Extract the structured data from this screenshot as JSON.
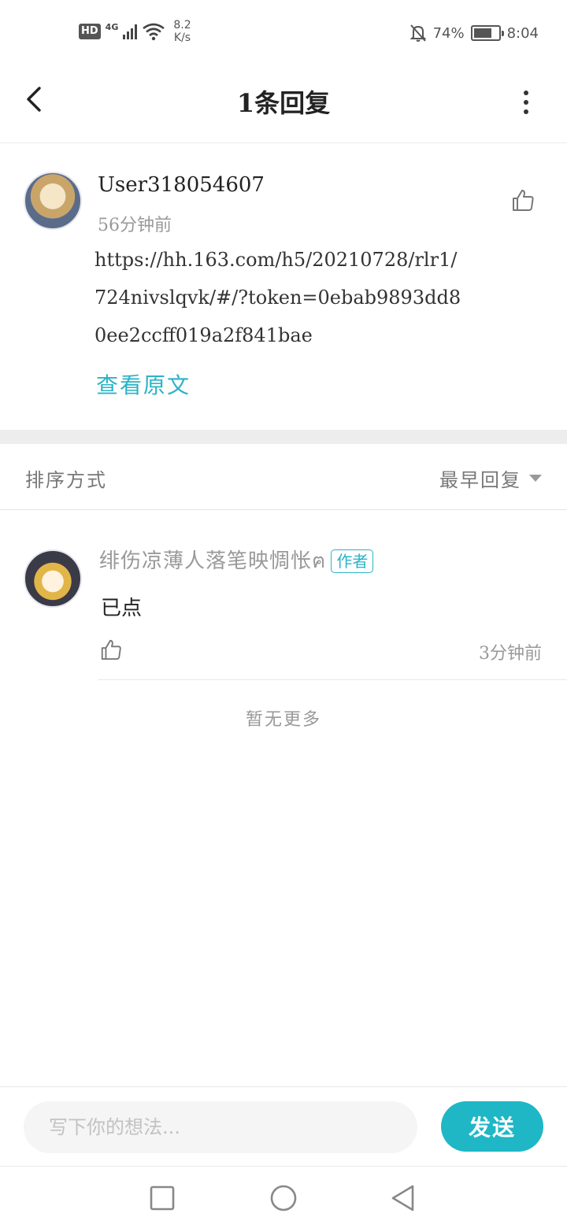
{
  "status_bar": {
    "hd": "HD",
    "network": "4G",
    "speed_value": "8.2",
    "speed_unit": "K/s",
    "battery_text": "74%",
    "battery_level": 0.74,
    "time": "8:04"
  },
  "header": {
    "title": "1条回复"
  },
  "post": {
    "author": "User318054607",
    "time": "56分钟前",
    "content": "https://hh.163.com/h5/20210728/rlr1/724nivslqvk/#/?token=0ebab9893dd80ee2ccff019a2f841bae",
    "view_original": "查看原文"
  },
  "sort": {
    "label": "排序方式",
    "selected": "最早回复"
  },
  "replies": [
    {
      "author": "绯伤凉薄人落笔映惆怅ฅ",
      "badge": "作者",
      "text": "已点",
      "time": "3分钟前"
    }
  ],
  "list_end": "暂无更多",
  "composer": {
    "placeholder": "写下你的想法...",
    "send_label": "发送",
    "accent": "#1fb7c6"
  },
  "icons": {
    "back": "chevron-left-icon",
    "more": "more-vertical-icon",
    "like": "thumbs-up-icon",
    "nav_recent": "square-icon",
    "nav_home": "circle-icon",
    "nav_back": "triangle-back-icon"
  }
}
